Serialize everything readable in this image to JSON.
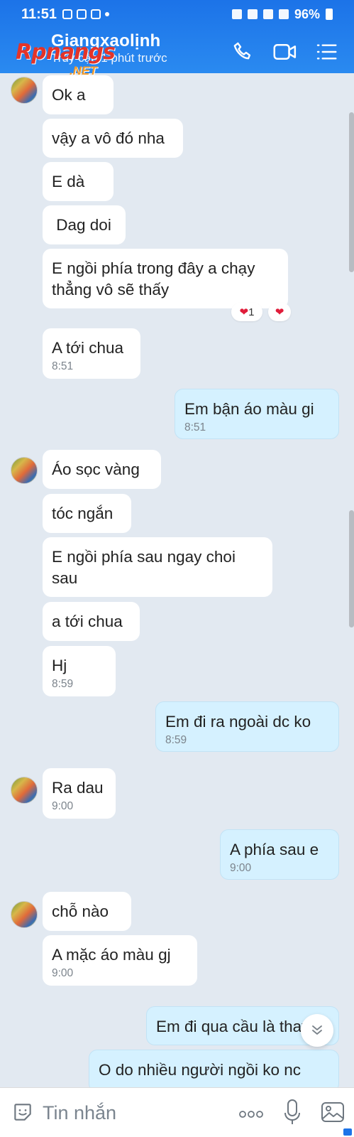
{
  "status_bar": {
    "time": "11:51",
    "battery": "96%"
  },
  "header": {
    "contact_name": "Giangxaolịnh",
    "last_seen": "Truy cập 1 phút trước",
    "watermark": "Rpnangs",
    "watermark_sub": ".NET"
  },
  "messages": [
    {
      "side": "received",
      "text": "Ok a",
      "time": ""
    },
    {
      "side": "received",
      "text": "vậy a vô đó nha",
      "time": ""
    },
    {
      "side": "received",
      "text": "E dà",
      "time": ""
    },
    {
      "side": "received",
      "text": " Dag doi",
      "time": ""
    },
    {
      "side": "received",
      "text": "E ngồi phía trong đây a chạy thẳng vô sẽ thấy",
      "time": "",
      "reaction_count": "1"
    },
    {
      "side": "received",
      "text": "A tới chua",
      "time": "8:51"
    },
    {
      "side": "sent",
      "text": "Em bận áo màu gi",
      "time": "8:51"
    },
    {
      "side": "received",
      "text": "Áo sọc vàng",
      "time": ""
    },
    {
      "side": "received",
      "text": "tóc ngắn",
      "time": ""
    },
    {
      "side": "received",
      "text": "E ngồi phía sau ngay choi sau",
      "time": ""
    },
    {
      "side": "received",
      "text": "a tới chua",
      "time": ""
    },
    {
      "side": "received",
      "text": "Hj",
      "time": "8:59"
    },
    {
      "side": "sent",
      "text": "Em đi ra ngoài dc ko",
      "time": "8:59"
    },
    {
      "side": "received",
      "text": "Ra dau",
      "time": "9:00"
    },
    {
      "side": "sent",
      "text": "A phía sau e",
      "time": "9:00"
    },
    {
      "side": "received",
      "text": "chỗ nào",
      "time": ""
    },
    {
      "side": "received",
      "text": "A mặc áo màu gj",
      "time": "9:00"
    },
    {
      "side": "sent",
      "text": "Em đi qua cầu là thay",
      "time": ""
    },
    {
      "side": "sent",
      "text": "O do nhiều người ngồi ko nc",
      "time": ""
    }
  ],
  "input_bar": {
    "placeholder": "Tin nhắn"
  },
  "icons": {
    "call": "phone-icon",
    "video": "video-camera-icon",
    "menu": "list-menu-icon",
    "sticker": "sticker-smile-icon",
    "more": "more-dots-icon",
    "mic": "microphone-icon",
    "gallery": "image-gallery-icon",
    "scroll": "scroll-down-chevrons-icon"
  },
  "colors": {
    "header": "#1c73e8",
    "sent_bubble": "#d5f1ff",
    "received_bubble": "#ffffff",
    "chat_bg": "#e2e9f1"
  }
}
